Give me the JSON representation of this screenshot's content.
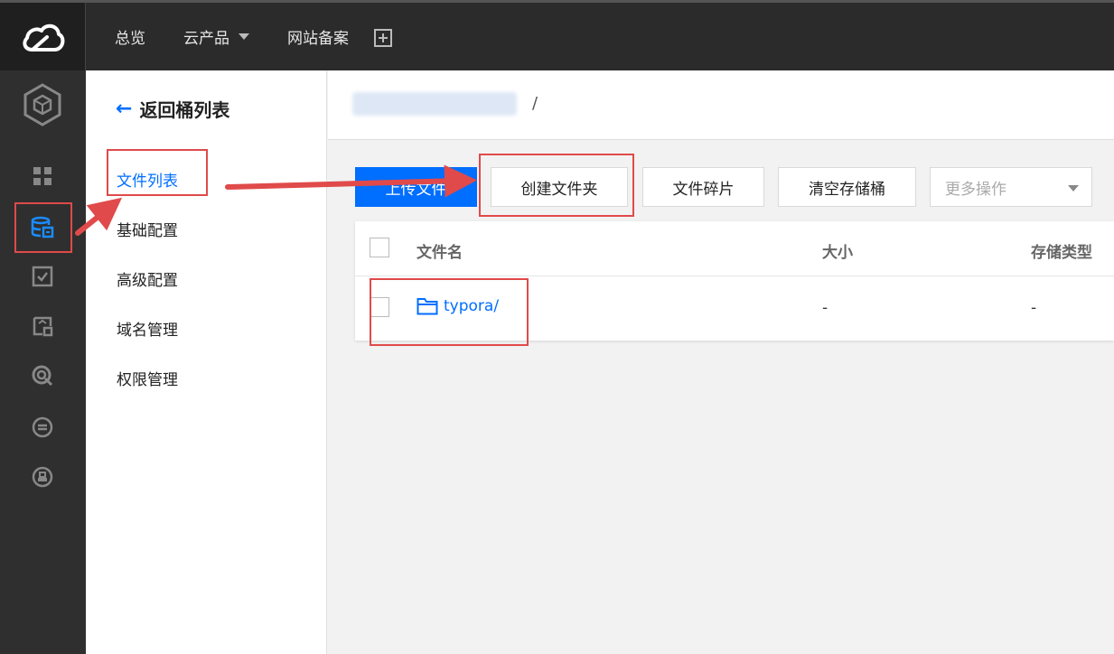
{
  "topnav": {
    "overview": "总览",
    "products": "云产品",
    "filing": "网站备案"
  },
  "sidebar": {
    "back_label": "返回桶列表",
    "items": [
      {
        "label": "文件列表",
        "active": true
      },
      {
        "label": "基础配置"
      },
      {
        "label": "高级配置"
      },
      {
        "label": "域名管理"
      },
      {
        "label": "权限管理"
      }
    ]
  },
  "breadcrumb": {
    "separator": "/"
  },
  "toolbar": {
    "upload_label": "上传文件",
    "create_folder_label": "创建文件夹",
    "fragments_label": "文件碎片",
    "clear_bucket_label": "清空存储桶",
    "more_label": "更多操作"
  },
  "table": {
    "headers": [
      "文件名",
      "大小",
      "存储类型"
    ],
    "rows": [
      {
        "name": "typora/",
        "size": "-",
        "storage": "-"
      }
    ]
  },
  "colors": {
    "accent": "#006eff",
    "annotation": "#e04a4a"
  },
  "icons": [
    "cloud-logo-icon",
    "cube-icon",
    "grid-icon",
    "storage-icon",
    "task-icon",
    "report-icon",
    "search-icon",
    "transfer-icon",
    "badge-icon",
    "folder-icon"
  ]
}
